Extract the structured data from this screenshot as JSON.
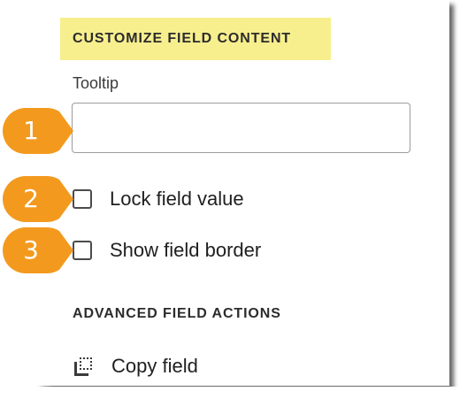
{
  "customize_section": {
    "title": "CUSTOMIZE FIELD CONTENT",
    "tooltip_label": "Tooltip",
    "tooltip_value": "",
    "tooltip_placeholder": ""
  },
  "checkboxes": {
    "lock_label": "Lock field value",
    "lock_checked": false,
    "border_label": "Show field border",
    "border_checked": false
  },
  "advanced_section": {
    "title": "ADVANCED FIELD ACTIONS",
    "copy_label": "Copy field",
    "copy_icon": "copy-icon"
  },
  "callouts": {
    "one": "1",
    "two": "2",
    "three": "3",
    "color": "#f39a1e"
  }
}
